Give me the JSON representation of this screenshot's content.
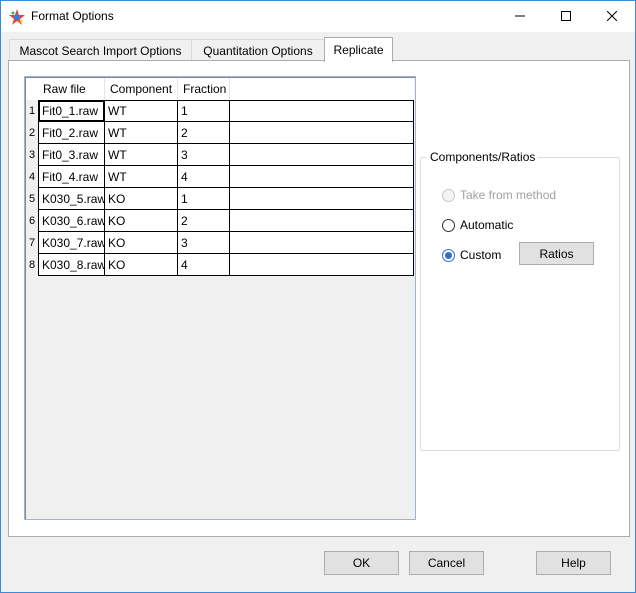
{
  "window": {
    "title": "Format Options",
    "icon": "app-logo-icon"
  },
  "tabs": [
    {
      "label": "Mascot Search Import Options",
      "active": false
    },
    {
      "label": "Quantitation Options",
      "active": false
    },
    {
      "label": "Replicate",
      "active": true
    }
  ],
  "grid": {
    "columns": [
      "Raw file",
      "Component",
      "Fraction"
    ],
    "rows": [
      {
        "num": "1",
        "raw_file": "Fit0_1.raw",
        "component": "WT",
        "fraction": "1"
      },
      {
        "num": "2",
        "raw_file": "Fit0_2.raw",
        "component": "WT",
        "fraction": "2"
      },
      {
        "num": "3",
        "raw_file": "Fit0_3.raw",
        "component": "WT",
        "fraction": "3"
      },
      {
        "num": "4",
        "raw_file": "Fit0_4.raw",
        "component": "WT",
        "fraction": "4"
      },
      {
        "num": "5",
        "raw_file": "K030_5.raw",
        "component": "KO",
        "fraction": "1"
      },
      {
        "num": "6",
        "raw_file": "K030_6.raw",
        "component": "KO",
        "fraction": "2"
      },
      {
        "num": "7",
        "raw_file": "K030_7.raw",
        "component": "KO",
        "fraction": "3"
      },
      {
        "num": "8",
        "raw_file": "K030_8.raw",
        "component": "KO",
        "fraction": "4"
      }
    ]
  },
  "components_ratios": {
    "title": "Components/Ratios",
    "options": [
      {
        "label": "Take from method",
        "disabled": true,
        "checked": false
      },
      {
        "label": "Automatic",
        "disabled": false,
        "checked": false
      },
      {
        "label": "Custom",
        "disabled": false,
        "checked": true
      }
    ],
    "ratios_button": "Ratios"
  },
  "footer": {
    "ok": "OK",
    "cancel": "Cancel",
    "help": "Help"
  },
  "colors": {
    "accent": "#2d6fc9",
    "window_border": "#3a8bd9"
  }
}
